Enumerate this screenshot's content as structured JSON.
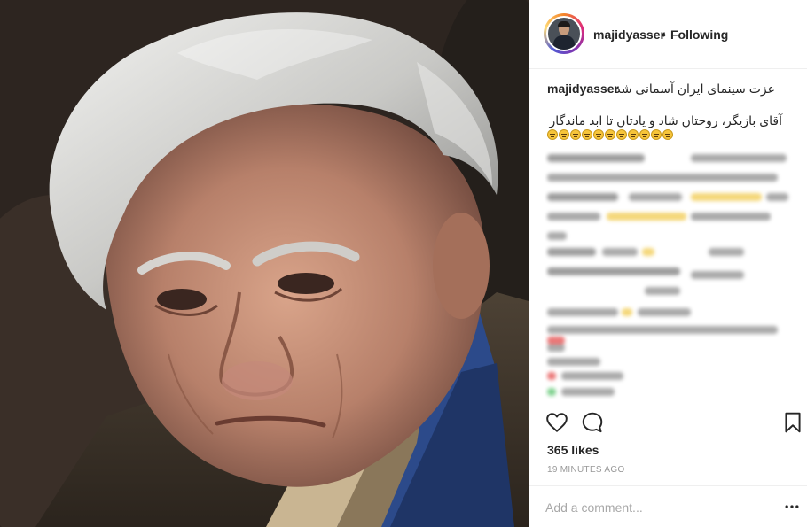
{
  "post": {
    "username": "majidyasser",
    "separator": "•",
    "follow_status": "Following",
    "caption_line1": "عزت سینمای ایران آسمانی شد",
    "caption_line2": "آقای بازیگر، روحتان شاد و یادتان تا ابد ماندگار",
    "emoji_count": 11,
    "likes": "365 likes",
    "time_ago": "19 MINUTES AGO",
    "comment_placeholder": "Add a comment...",
    "icons": {
      "like": "heart-icon",
      "comment": "comment-bubble-icon",
      "save": "bookmark-icon",
      "more": "more-options-icon"
    }
  }
}
